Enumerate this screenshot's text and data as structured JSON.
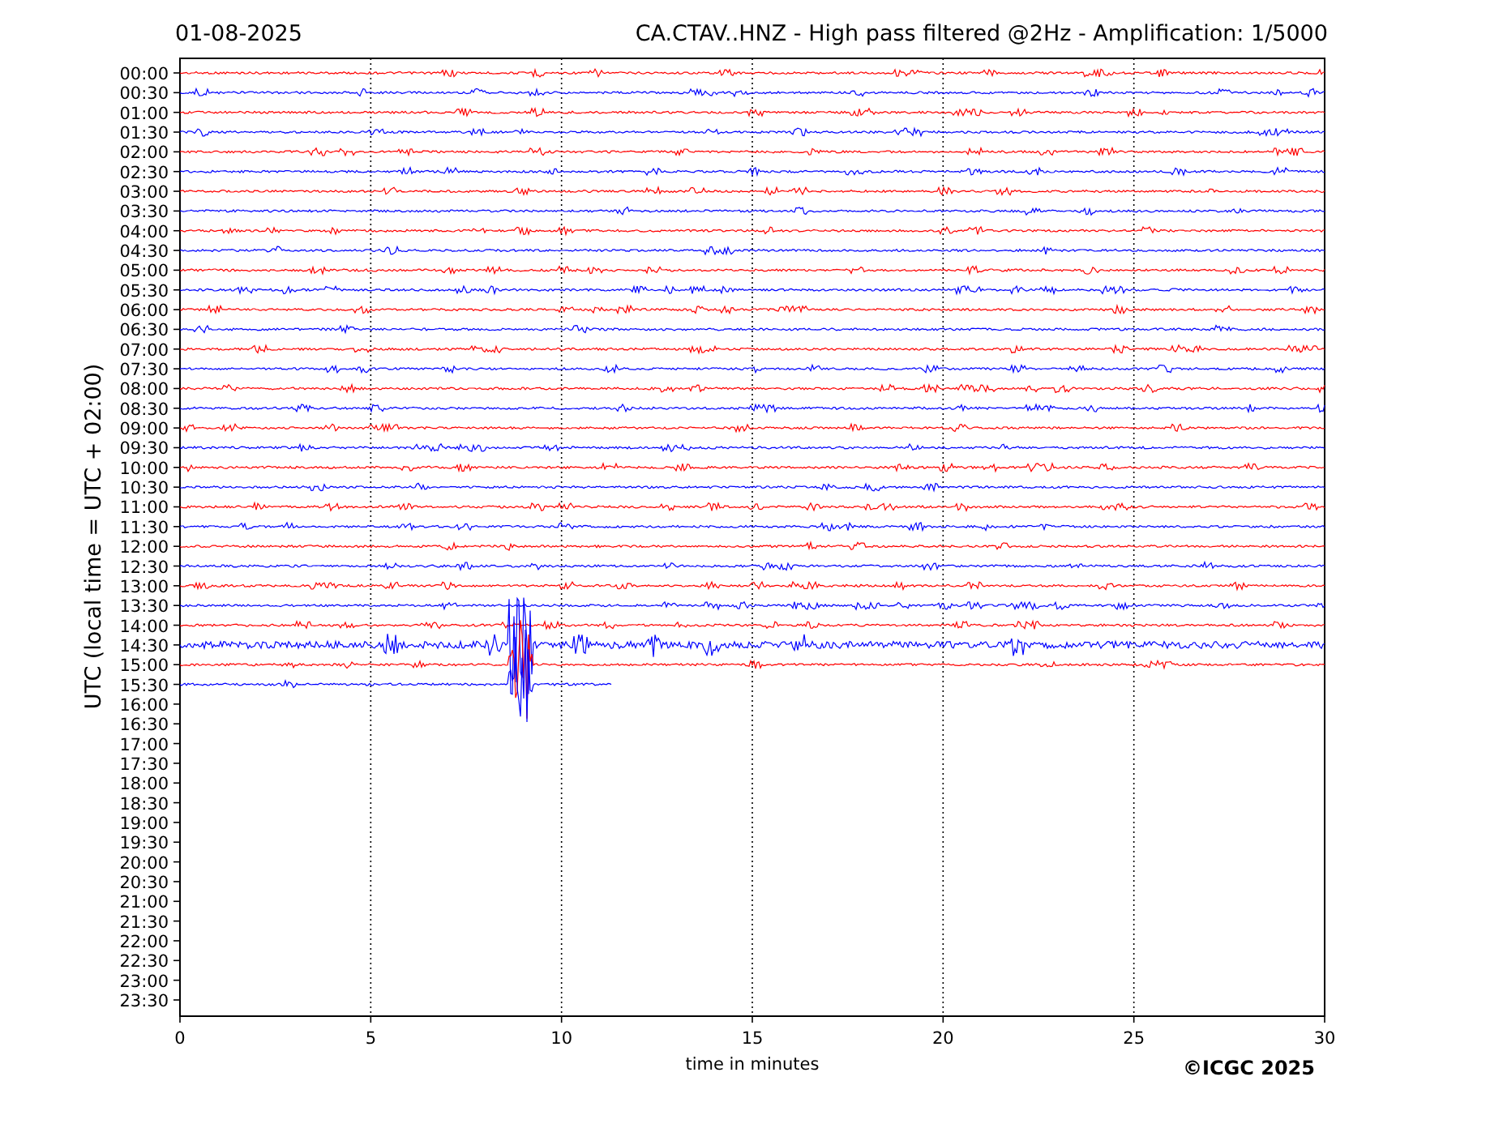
{
  "header": {
    "date": "01-08-2025",
    "title": "CA.CTAV..HNZ - High pass filtered @2Hz - Amplification: 1/5000"
  },
  "plot": {
    "ylabel": "UTC (local time = UTC + 02:00)",
    "xlabel": "time in minutes",
    "xticks": [
      "0",
      "5",
      "10",
      "15",
      "20",
      "25",
      "30"
    ],
    "rows": [
      "00:00",
      "00:30",
      "01:00",
      "01:30",
      "02:00",
      "02:30",
      "03:00",
      "03:30",
      "04:00",
      "04:30",
      "05:00",
      "05:30",
      "06:00",
      "06:30",
      "07:00",
      "07:30",
      "08:00",
      "08:30",
      "09:00",
      "09:30",
      "10:00",
      "10:30",
      "11:00",
      "11:30",
      "12:00",
      "12:30",
      "13:00",
      "13:30",
      "14:00",
      "14:30",
      "15:00",
      "15:30",
      "16:00",
      "16:30",
      "17:00",
      "17:30",
      "18:00",
      "18:30",
      "19:00",
      "19:30",
      "20:00",
      "20:30",
      "21:00",
      "21:30",
      "22:00",
      "22:30",
      "23:00",
      "23:30"
    ],
    "traces": [
      {
        "color": "#ff0000",
        "level": 1
      },
      {
        "color": "#0000ff",
        "level": 1
      },
      {
        "color": "#ff0000",
        "level": 1
      },
      {
        "color": "#0000ff",
        "level": 1
      },
      {
        "color": "#ff0000",
        "level": 1
      },
      {
        "color": "#0000ff",
        "level": 1
      },
      {
        "color": "#ff0000",
        "level": 1
      },
      {
        "color": "#0000ff",
        "level": 1
      },
      {
        "color": "#ff0000",
        "level": 1
      },
      {
        "color": "#0000ff",
        "level": 1
      },
      {
        "color": "#ff0000",
        "level": 1
      },
      {
        "color": "#0000ff",
        "level": 1
      },
      {
        "color": "#ff0000",
        "level": 1
      },
      {
        "color": "#0000ff",
        "level": 1
      },
      {
        "color": "#ff0000",
        "level": 1
      },
      {
        "color": "#0000ff",
        "level": 1
      },
      {
        "color": "#ff0000",
        "level": 1
      },
      {
        "color": "#0000ff",
        "level": 1
      },
      {
        "color": "#ff0000",
        "level": 1
      },
      {
        "color": "#0000ff",
        "level": 1
      },
      {
        "color": "#ff0000",
        "level": 1
      },
      {
        "color": "#0000ff",
        "level": 1
      },
      {
        "color": "#ff0000",
        "level": 1
      },
      {
        "color": "#0000ff",
        "level": 1
      },
      {
        "color": "#ff0000",
        "level": 1
      },
      {
        "color": "#0000ff",
        "level": 1
      },
      {
        "color": "#ff0000",
        "level": 1
      },
      {
        "color": "#0000ff",
        "level": 1
      },
      {
        "color": "#ff0000",
        "level": 1
      },
      {
        "color": "#0000ff",
        "level": 1
      },
      {
        "color": "#ff0000",
        "level": 1
      },
      {
        "color": "#0000ff",
        "level": 0.377
      }
    ]
  },
  "footer": {
    "copyright": "©ICGC 2025"
  }
}
